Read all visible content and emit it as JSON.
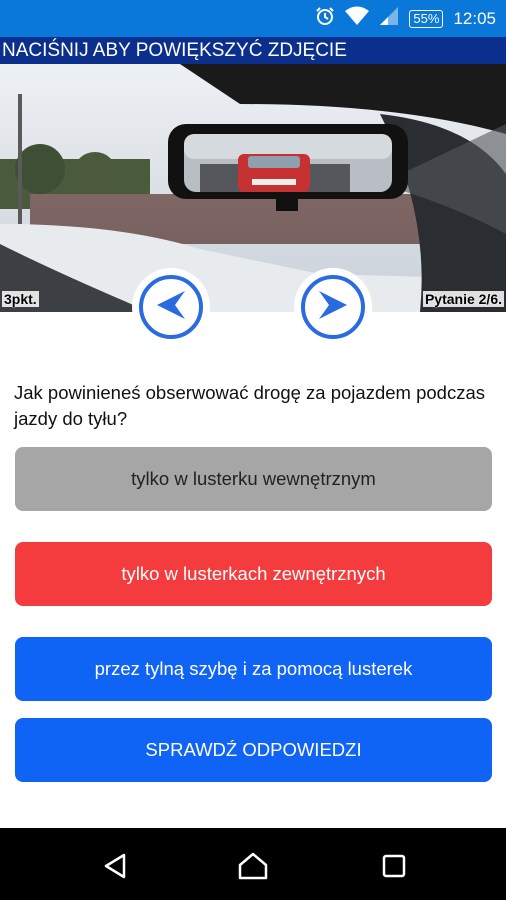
{
  "status_bar": {
    "battery": "55%",
    "time": "12:05",
    "icons": [
      "alarm-icon",
      "wifi-icon",
      "signal-icon",
      "battery-icon"
    ]
  },
  "title_bar": {
    "label": "NACIŚNIJ ABY POWIĘKSZYĆ ZDJĘCIE"
  },
  "photo": {
    "points": "3pkt.",
    "counter": "Pytanie 2/6."
  },
  "navigation": {
    "prev_icon": "chevron-left-icon",
    "next_icon": "chevron-right-icon"
  },
  "question": {
    "text": "Jak powinieneś obserwować drogę za pojazdem podczas jazdy do tyłu?"
  },
  "answers": [
    {
      "label": "tylko w lusterku wewnętrznym",
      "color": "#a6a6a6"
    },
    {
      "label": "tylko w lusterkach zewnętrznych",
      "color": "#f43c3f"
    },
    {
      "label": "przez tylną szybę i za pomocą lusterek",
      "color": "#0f63f5"
    }
  ],
  "check_button": {
    "label": "SPRAWDŹ ODPOWIEDZI",
    "color": "#0f63f5"
  },
  "system_nav": {
    "icons": [
      "back-icon",
      "home-icon",
      "recents-icon"
    ]
  }
}
